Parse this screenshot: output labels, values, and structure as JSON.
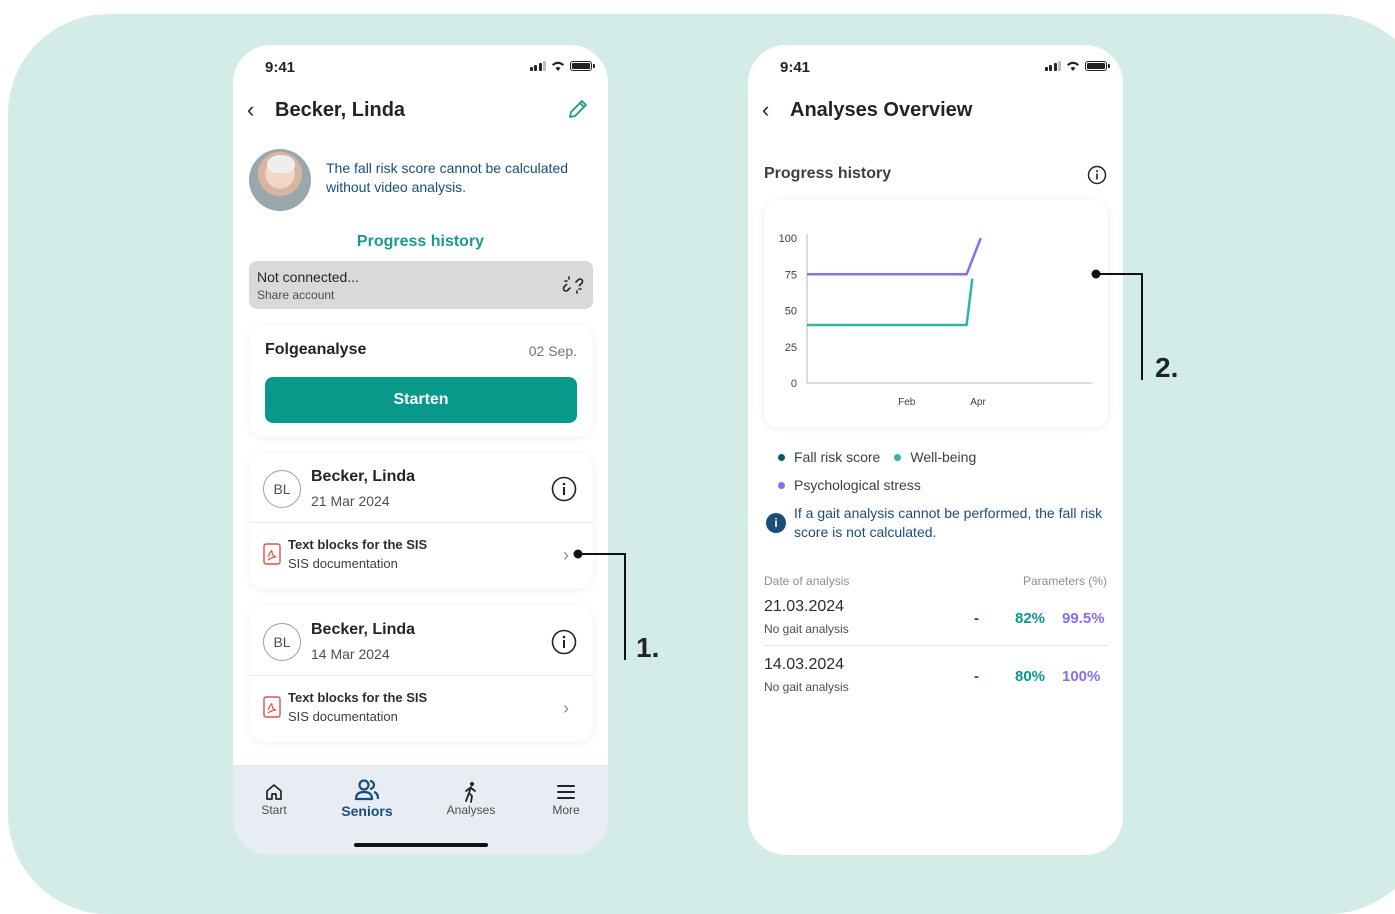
{
  "colors": {
    "teal": "#08998a",
    "blue": "#1a4e7a",
    "purple": "#8a6cf0",
    "dark_teal": "#0c5763",
    "background": "#d4ece8"
  },
  "phone1": {
    "status_time": "9:41",
    "title": "Becker, Linda",
    "notice": "The fall risk score cannot be calculated without video analysis.",
    "progress_history": "Progress history",
    "not_connected": {
      "title": "Not connected...",
      "subtitle": "Share account"
    },
    "follow": {
      "title": "Folgeanalyse",
      "date": "02 Sep.",
      "button": "Starten"
    },
    "entries": [
      {
        "initials": "BL",
        "name": "Becker, Linda",
        "date": "21 Mar 2024",
        "doc_title": "Text blocks for the SIS",
        "doc_sub": "SIS documentation"
      },
      {
        "initials": "BL",
        "name": "Becker, Linda",
        "date": "14 Mar 2024",
        "doc_title": "Text blocks for the SIS",
        "doc_sub": "SIS documentation"
      }
    ],
    "tabs": [
      {
        "label": "Start",
        "icon": "home-icon"
      },
      {
        "label": "Seniors",
        "icon": "users-icon"
      },
      {
        "label": "Analyses",
        "icon": "walking-icon"
      },
      {
        "label": "More",
        "icon": "menu-icon"
      }
    ]
  },
  "phone2": {
    "status_time": "9:41",
    "title": "Analyses Overview",
    "section": "Progress history",
    "legend": [
      "Fall risk score",
      "Well-being",
      "Psychological stress"
    ],
    "notice": "If a gait analysis cannot be performed, the fall risk score is not calculated.",
    "table_header": {
      "left": "Date of analysis",
      "right": "Parameters (%)"
    },
    "rows": [
      {
        "date": "21.03.2024",
        "sub": "No gait analysis",
        "v1": "-",
        "v2": "82%",
        "v3": "99.5%"
      },
      {
        "date": "14.03.2024",
        "sub": "No gait analysis",
        "v1": "-",
        "v2": "80%",
        "v3": "100%"
      }
    ]
  },
  "chart_data": {
    "type": "line",
    "x_ticks": [
      "Feb",
      "Apr"
    ],
    "y_ticks": [
      0,
      25,
      50,
      75,
      100
    ],
    "ylim": [
      0,
      100
    ],
    "series": [
      {
        "name": "Well-being",
        "color": "#2fb5a4",
        "points": [
          [
            0,
            40
          ],
          [
            0.56,
            40
          ],
          [
            0.58,
            72
          ]
        ]
      },
      {
        "name": "Psychological stress",
        "color": "#8a6cf0",
        "points": [
          [
            0,
            75
          ],
          [
            0.56,
            75
          ],
          [
            0.61,
            100
          ]
        ]
      }
    ]
  },
  "callouts": [
    "1.",
    "2."
  ]
}
